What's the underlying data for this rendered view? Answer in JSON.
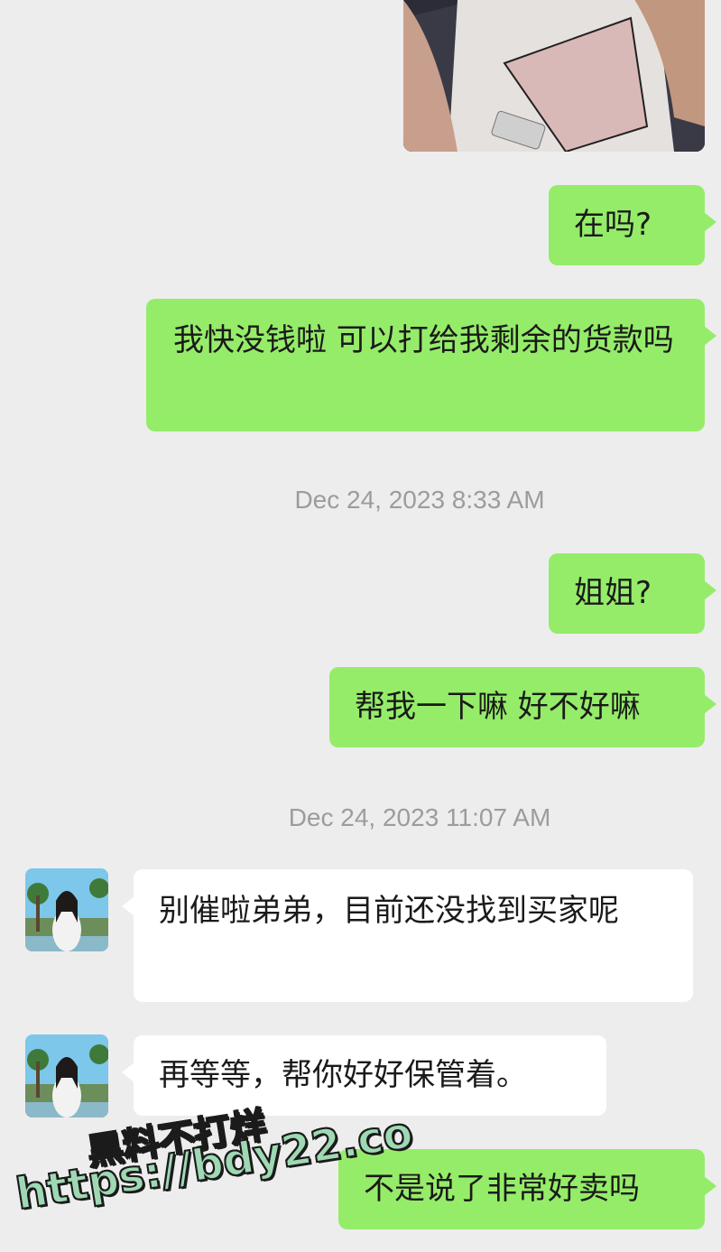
{
  "messages": [
    {
      "id": "m1",
      "text": "在吗?"
    },
    {
      "id": "m2",
      "text": "我快没钱啦 可以打给我剩余的货款吗"
    },
    {
      "id": "m3",
      "text": "姐姐?"
    },
    {
      "id": "m4",
      "text": "帮我一下嘛 好不好嘛"
    },
    {
      "id": "m5",
      "text": "别催啦弟弟，目前还没找到买家呢"
    },
    {
      "id": "m6",
      "text": "再等等，帮你好好保管着。"
    },
    {
      "id": "m7",
      "text": "不是说了非常好卖吗"
    }
  ],
  "timestamps": [
    "Dec 24, 2023 8:33 AM",
    "Dec 24, 2023 11:07 AM"
  ],
  "watermark": {
    "line1": "黑料不打烊",
    "line2": "https://bdy22.co"
  },
  "colors": {
    "outgoing_bubble": "#95ec69",
    "incoming_bubble": "#ffffff",
    "background": "#ededed",
    "timestamp": "#9c9c9c"
  }
}
